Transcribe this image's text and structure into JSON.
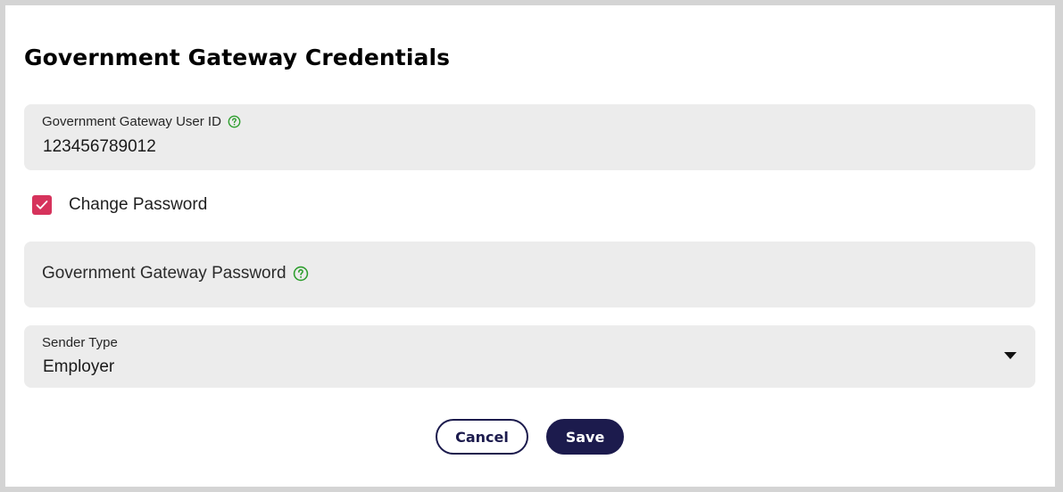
{
  "dialog": {
    "title": "Government Gateway Credentials"
  },
  "user_id_field": {
    "label": "Government Gateway User ID",
    "value": "123456789012",
    "help_icon": "question-circle-icon"
  },
  "change_password": {
    "label": "Change Password",
    "checked": true
  },
  "password_field": {
    "placeholder": "Government Gateway Password",
    "help_icon": "question-circle-icon"
  },
  "sender_type": {
    "label": "Sender Type",
    "value": "Employer",
    "icon": "caret-down-icon"
  },
  "buttons": {
    "cancel": "Cancel",
    "save": "Save"
  },
  "colors": {
    "accent": "#d6335c",
    "primary": "#1c1b4d",
    "help": "#2e9e2e",
    "field_bg": "#ececec"
  }
}
